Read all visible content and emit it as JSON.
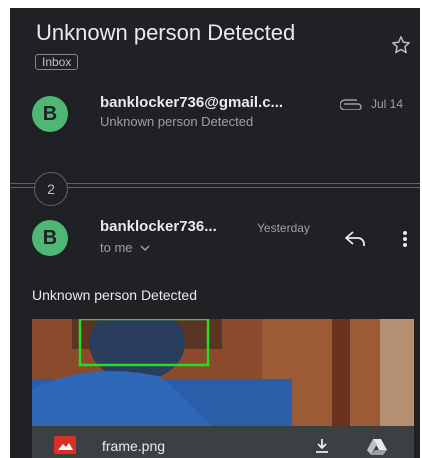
{
  "thread": {
    "subject": "Unknown person Detected",
    "label": "Inbox"
  },
  "first_message": {
    "avatar_letter": "B",
    "sender": "banklocker736@gmail.c...",
    "date": "Jul 14",
    "snippet": "Unknown person Detected"
  },
  "collapsed_count": "2",
  "latest_message": {
    "avatar_letter": "B",
    "sender": "banklocker736...",
    "date": "Yesterday",
    "recipient": "to me",
    "body": "Unknown person Detected",
    "attachment": {
      "filename": "frame.png"
    }
  },
  "colors": {
    "background": "#202124",
    "avatar": "#4fb775",
    "detection_box": "#22dd22",
    "attachment_bar": "#3c4043"
  }
}
